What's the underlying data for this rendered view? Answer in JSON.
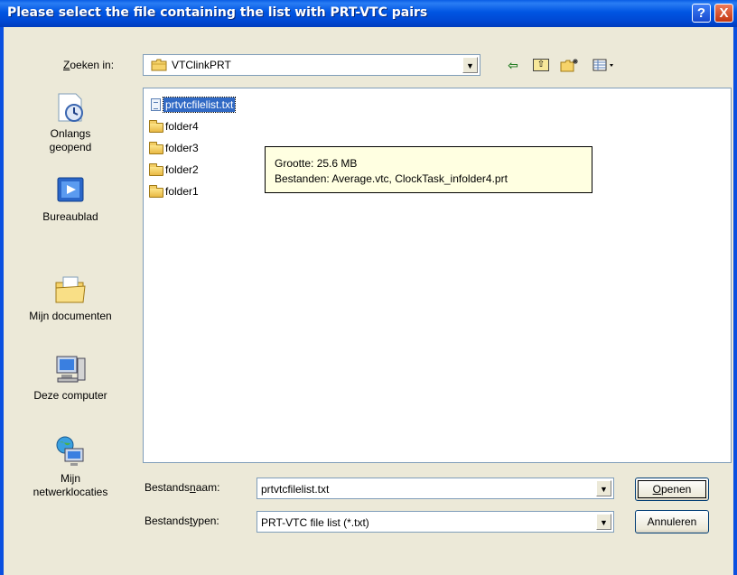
{
  "window": {
    "title": "Please select the file containing the list with PRT-VTC pairs",
    "help_glyph": "?",
    "close_glyph": "X"
  },
  "lookin": {
    "label_prefix": "",
    "label_access": "Z",
    "label_rest": "oeken in:",
    "value": "VTClinkPRT"
  },
  "toolbar": {
    "back_icon": "back-arrow-icon",
    "up_icon": "up-folder-icon",
    "new_folder_icon": "new-folder-icon",
    "view_icon": "view-menu-icon"
  },
  "places": [
    {
      "label_line1": "Onlangs",
      "label_line2": "geopend",
      "icon": "recent-documents-icon"
    },
    {
      "label_line1": "Bureaublad",
      "label_line2": "",
      "icon": "desktop-icon"
    },
    {
      "label_line1": "Mijn documenten",
      "label_line2": "",
      "icon": "my-documents-icon"
    },
    {
      "label_line1": "Deze computer",
      "label_line2": "",
      "icon": "my-computer-icon"
    },
    {
      "label_line1": "Mijn",
      "label_line2": "netwerklocaties",
      "icon": "network-places-icon"
    }
  ],
  "files": [
    {
      "name": "prtvtcfilelist.txt",
      "type": "text",
      "selected": true
    },
    {
      "name": "folder4",
      "type": "folder",
      "selected": false
    },
    {
      "name": "folder3",
      "type": "folder",
      "selected": false
    },
    {
      "name": "folder2",
      "type": "folder",
      "selected": false
    },
    {
      "name": "folder1",
      "type": "folder",
      "selected": false
    }
  ],
  "tooltip": {
    "line1": "Grootte: 25.6 MB",
    "line2": "Bestanden: Average.vtc, ClockTask_infolder4.prt"
  },
  "filename": {
    "label_pre": "Bestands",
    "label_access": "n",
    "label_post": "aam:",
    "value": "prtvtcfilelist.txt"
  },
  "filetype": {
    "label_pre": "Bestands",
    "label_access": "t",
    "label_post": "ypen:",
    "value": "PRT-VTC file list (*.txt)"
  },
  "buttons": {
    "open_access": "O",
    "open_rest": "penen",
    "cancel": "Annuleren"
  }
}
